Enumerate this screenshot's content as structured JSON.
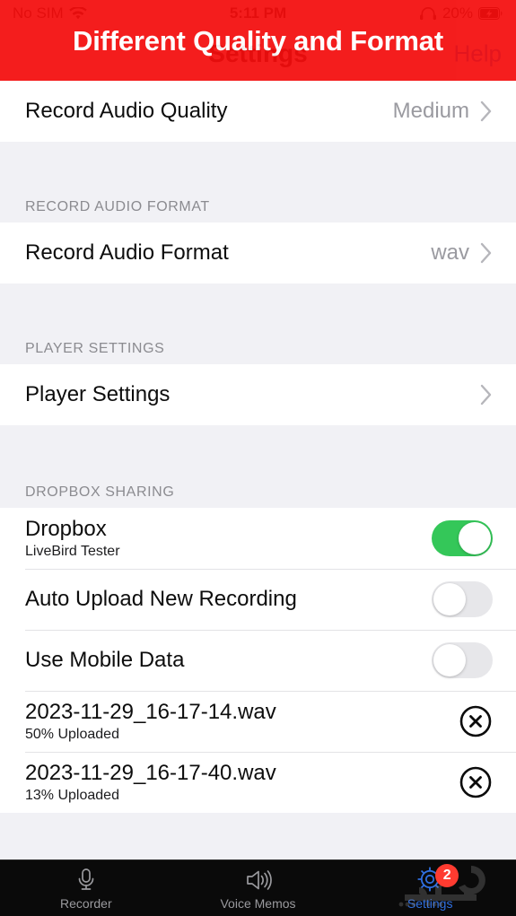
{
  "status_bar": {
    "carrier": "No SIM",
    "wifi_icon": "wifi-icon",
    "time": "5:11 PM",
    "headphones_icon": "headphones-icon",
    "battery_percent": "20%",
    "battery_icon": "battery-charging-icon"
  },
  "nav_bar": {
    "title": "Settings",
    "right_button": "Help"
  },
  "banner": {
    "text": "Different Quality and Format",
    "color": "#F40D0D"
  },
  "sections": [
    {
      "header": "",
      "rows": [
        {
          "name": "record-audio-quality",
          "title": "Record Audio Quality",
          "value": "Medium",
          "accessory": "chevron"
        }
      ]
    },
    {
      "header": "RECORD AUDIO FORMAT",
      "rows": [
        {
          "name": "record-audio-format",
          "title": "Record Audio Format",
          "value": "wav",
          "accessory": "chevron"
        }
      ]
    },
    {
      "header": "PLAYER SETTINGS",
      "rows": [
        {
          "name": "player-settings",
          "title": "Player Settings",
          "value": "",
          "accessory": "chevron"
        }
      ]
    },
    {
      "header": "DROPBOX SHARING",
      "rows": [
        {
          "name": "dropbox",
          "title": "Dropbox",
          "subtitle": "LiveBird Tester",
          "accessory": "toggle",
          "toggle_on": true
        },
        {
          "name": "auto-upload-new-recording",
          "title": "Auto Upload New Recording",
          "accessory": "toggle",
          "toggle_on": false
        },
        {
          "name": "use-mobile-data",
          "title": "Use Mobile Data",
          "accessory": "toggle",
          "toggle_on": false
        },
        {
          "name": "upload-item-1",
          "title": "2023-11-29_16-17-14.wav",
          "subtitle": "50% Uploaded",
          "accessory": "cancel"
        },
        {
          "name": "upload-item-2",
          "title": "2023-11-29_16-17-40.wav",
          "subtitle": "13% Uploaded",
          "accessory": "cancel"
        }
      ]
    }
  ],
  "tab_bar": {
    "tabs": [
      {
        "name": "recorder",
        "label": "Recorder",
        "icon": "microphone-icon",
        "active": false
      },
      {
        "name": "voice-memos",
        "label": "Voice Memos",
        "icon": "speaker-icon",
        "active": false
      },
      {
        "name": "settings",
        "label": "Settings",
        "icon": "gear-icon",
        "active": true,
        "badge": "2"
      }
    ],
    "accent_color": "#2f6fe0",
    "badge_color": "#FF3B30"
  },
  "colors": {
    "toggle_on": "#34C759",
    "toggle_off": "#E7E7EA",
    "group_background": "#F1F1F5"
  }
}
